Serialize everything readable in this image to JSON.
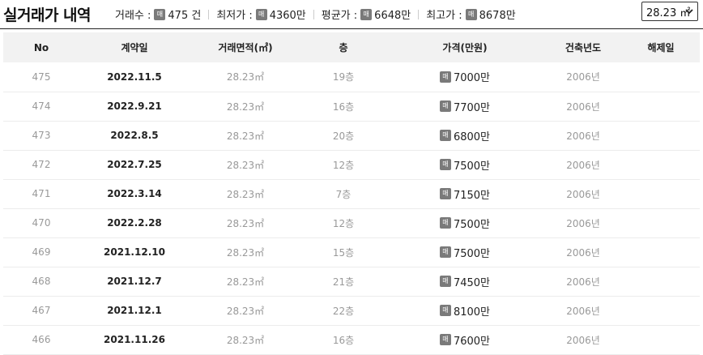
{
  "header": {
    "title": "실거래가 내역",
    "stats": [
      {
        "label": "거래수 :",
        "badge": "매",
        "value": "475 건"
      },
      {
        "label": "최저가 :",
        "badge": "매",
        "value": "4360만"
      },
      {
        "label": "평균가 :",
        "badge": "매",
        "value": "6648만"
      },
      {
        "label": "최고가 :",
        "badge": "매",
        "value": "8678만"
      }
    ],
    "area_select": {
      "selected": "28.23 ㎡"
    }
  },
  "table": {
    "columns": [
      "No",
      "계약일",
      "거래면적(㎡)",
      "층",
      "가격(만원)",
      "건축년도",
      "해제일"
    ],
    "rows": [
      {
        "no": "475",
        "date": "2022.11.5",
        "area": "28.23㎡",
        "floor": "19층",
        "badge": "매",
        "price": "7000만",
        "year": "2006년",
        "cancel": ""
      },
      {
        "no": "474",
        "date": "2022.9.21",
        "area": "28.23㎡",
        "floor": "16층",
        "badge": "매",
        "price": "7700만",
        "year": "2006년",
        "cancel": ""
      },
      {
        "no": "473",
        "date": "2022.8.5",
        "area": "28.23㎡",
        "floor": "20층",
        "badge": "매",
        "price": "6800만",
        "year": "2006년",
        "cancel": ""
      },
      {
        "no": "472",
        "date": "2022.7.25",
        "area": "28.23㎡",
        "floor": "12층",
        "badge": "매",
        "price": "7500만",
        "year": "2006년",
        "cancel": ""
      },
      {
        "no": "471",
        "date": "2022.3.14",
        "area": "28.23㎡",
        "floor": "7층",
        "badge": "매",
        "price": "7150만",
        "year": "2006년",
        "cancel": ""
      },
      {
        "no": "470",
        "date": "2022.2.28",
        "area": "28.23㎡",
        "floor": "12층",
        "badge": "매",
        "price": "7500만",
        "year": "2006년",
        "cancel": ""
      },
      {
        "no": "469",
        "date": "2021.12.10",
        "area": "28.23㎡",
        "floor": "15층",
        "badge": "매",
        "price": "7500만",
        "year": "2006년",
        "cancel": ""
      },
      {
        "no": "468",
        "date": "2021.12.7",
        "area": "28.23㎡",
        "floor": "21층",
        "badge": "매",
        "price": "7450만",
        "year": "2006년",
        "cancel": ""
      },
      {
        "no": "467",
        "date": "2021.12.1",
        "area": "28.23㎡",
        "floor": "22층",
        "badge": "매",
        "price": "8100만",
        "year": "2006년",
        "cancel": ""
      },
      {
        "no": "466",
        "date": "2021.11.26",
        "area": "28.23㎡",
        "floor": "16층",
        "badge": "매",
        "price": "7600만",
        "year": "2006년",
        "cancel": ""
      }
    ]
  }
}
